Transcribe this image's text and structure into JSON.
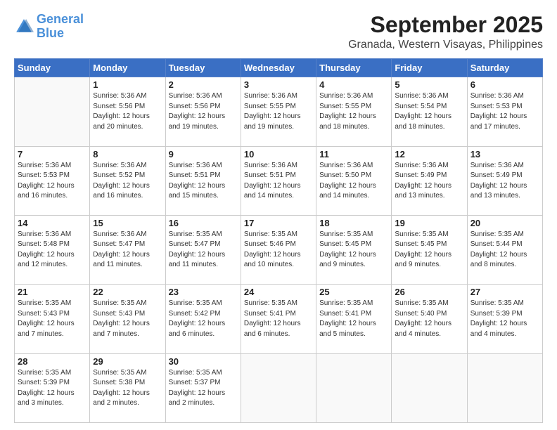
{
  "header": {
    "logo_line1": "General",
    "logo_line2": "Blue",
    "title": "September 2025",
    "subtitle": "Granada, Western Visayas, Philippines"
  },
  "weekdays": [
    "Sunday",
    "Monday",
    "Tuesday",
    "Wednesday",
    "Thursday",
    "Friday",
    "Saturday"
  ],
  "weeks": [
    [
      {
        "day": "",
        "info": ""
      },
      {
        "day": "1",
        "info": "Sunrise: 5:36 AM\nSunset: 5:56 PM\nDaylight: 12 hours\nand 20 minutes."
      },
      {
        "day": "2",
        "info": "Sunrise: 5:36 AM\nSunset: 5:56 PM\nDaylight: 12 hours\nand 19 minutes."
      },
      {
        "day": "3",
        "info": "Sunrise: 5:36 AM\nSunset: 5:55 PM\nDaylight: 12 hours\nand 19 minutes."
      },
      {
        "day": "4",
        "info": "Sunrise: 5:36 AM\nSunset: 5:55 PM\nDaylight: 12 hours\nand 18 minutes."
      },
      {
        "day": "5",
        "info": "Sunrise: 5:36 AM\nSunset: 5:54 PM\nDaylight: 12 hours\nand 18 minutes."
      },
      {
        "day": "6",
        "info": "Sunrise: 5:36 AM\nSunset: 5:53 PM\nDaylight: 12 hours\nand 17 minutes."
      }
    ],
    [
      {
        "day": "7",
        "info": "Sunrise: 5:36 AM\nSunset: 5:53 PM\nDaylight: 12 hours\nand 16 minutes."
      },
      {
        "day": "8",
        "info": "Sunrise: 5:36 AM\nSunset: 5:52 PM\nDaylight: 12 hours\nand 16 minutes."
      },
      {
        "day": "9",
        "info": "Sunrise: 5:36 AM\nSunset: 5:51 PM\nDaylight: 12 hours\nand 15 minutes."
      },
      {
        "day": "10",
        "info": "Sunrise: 5:36 AM\nSunset: 5:51 PM\nDaylight: 12 hours\nand 14 minutes."
      },
      {
        "day": "11",
        "info": "Sunrise: 5:36 AM\nSunset: 5:50 PM\nDaylight: 12 hours\nand 14 minutes."
      },
      {
        "day": "12",
        "info": "Sunrise: 5:36 AM\nSunset: 5:49 PM\nDaylight: 12 hours\nand 13 minutes."
      },
      {
        "day": "13",
        "info": "Sunrise: 5:36 AM\nSunset: 5:49 PM\nDaylight: 12 hours\nand 13 minutes."
      }
    ],
    [
      {
        "day": "14",
        "info": "Sunrise: 5:36 AM\nSunset: 5:48 PM\nDaylight: 12 hours\nand 12 minutes."
      },
      {
        "day": "15",
        "info": "Sunrise: 5:36 AM\nSunset: 5:47 PM\nDaylight: 12 hours\nand 11 minutes."
      },
      {
        "day": "16",
        "info": "Sunrise: 5:35 AM\nSunset: 5:47 PM\nDaylight: 12 hours\nand 11 minutes."
      },
      {
        "day": "17",
        "info": "Sunrise: 5:35 AM\nSunset: 5:46 PM\nDaylight: 12 hours\nand 10 minutes."
      },
      {
        "day": "18",
        "info": "Sunrise: 5:35 AM\nSunset: 5:45 PM\nDaylight: 12 hours\nand 9 minutes."
      },
      {
        "day": "19",
        "info": "Sunrise: 5:35 AM\nSunset: 5:45 PM\nDaylight: 12 hours\nand 9 minutes."
      },
      {
        "day": "20",
        "info": "Sunrise: 5:35 AM\nSunset: 5:44 PM\nDaylight: 12 hours\nand 8 minutes."
      }
    ],
    [
      {
        "day": "21",
        "info": "Sunrise: 5:35 AM\nSunset: 5:43 PM\nDaylight: 12 hours\nand 7 minutes."
      },
      {
        "day": "22",
        "info": "Sunrise: 5:35 AM\nSunset: 5:43 PM\nDaylight: 12 hours\nand 7 minutes."
      },
      {
        "day": "23",
        "info": "Sunrise: 5:35 AM\nSunset: 5:42 PM\nDaylight: 12 hours\nand 6 minutes."
      },
      {
        "day": "24",
        "info": "Sunrise: 5:35 AM\nSunset: 5:41 PM\nDaylight: 12 hours\nand 6 minutes."
      },
      {
        "day": "25",
        "info": "Sunrise: 5:35 AM\nSunset: 5:41 PM\nDaylight: 12 hours\nand 5 minutes."
      },
      {
        "day": "26",
        "info": "Sunrise: 5:35 AM\nSunset: 5:40 PM\nDaylight: 12 hours\nand 4 minutes."
      },
      {
        "day": "27",
        "info": "Sunrise: 5:35 AM\nSunset: 5:39 PM\nDaylight: 12 hours\nand 4 minutes."
      }
    ],
    [
      {
        "day": "28",
        "info": "Sunrise: 5:35 AM\nSunset: 5:39 PM\nDaylight: 12 hours\nand 3 minutes."
      },
      {
        "day": "29",
        "info": "Sunrise: 5:35 AM\nSunset: 5:38 PM\nDaylight: 12 hours\nand 2 minutes."
      },
      {
        "day": "30",
        "info": "Sunrise: 5:35 AM\nSunset: 5:37 PM\nDaylight: 12 hours\nand 2 minutes."
      },
      {
        "day": "",
        "info": ""
      },
      {
        "day": "",
        "info": ""
      },
      {
        "day": "",
        "info": ""
      },
      {
        "day": "",
        "info": ""
      }
    ]
  ]
}
